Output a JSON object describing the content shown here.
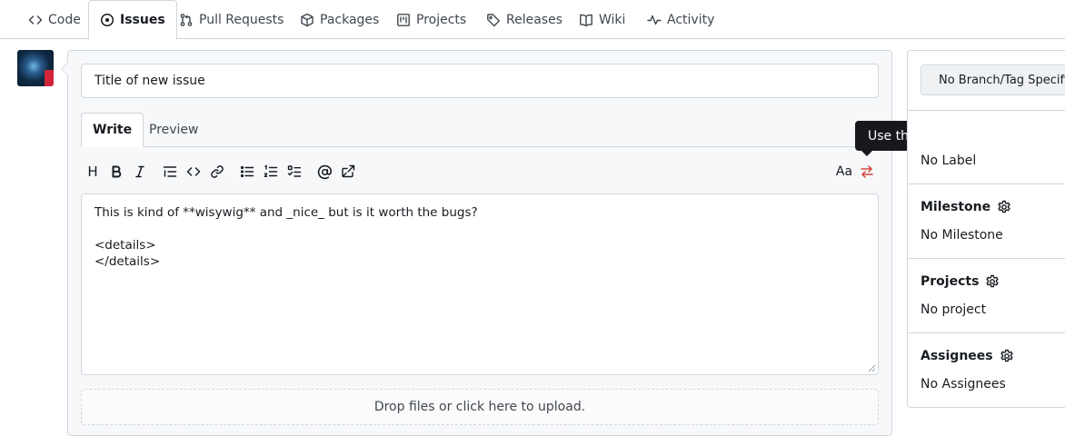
{
  "nav": {
    "tabs": [
      {
        "label": "Code",
        "icon": "code-icon"
      },
      {
        "label": "Issues",
        "icon": "issue-icon",
        "active": true
      },
      {
        "label": "Pull Requests",
        "icon": "pull-request-icon"
      },
      {
        "label": "Packages",
        "icon": "package-icon"
      },
      {
        "label": "Projects",
        "icon": "project-icon"
      },
      {
        "label": "Releases",
        "icon": "tag-icon"
      },
      {
        "label": "Wiki",
        "icon": "book-icon"
      },
      {
        "label": "Activity",
        "icon": "pulse-icon"
      }
    ]
  },
  "issue": {
    "title_placeholder": "Title of new issue",
    "tabs": {
      "write": "Write",
      "preview": "Preview"
    },
    "toolbar": {
      "heading": "H",
      "font_toggle": "Aa"
    },
    "body": "This is kind of **wisywig** and _nice_ but is it worth the bugs?\n\n<details>\n</details>",
    "dropzone": "Drop files or click here to upload.",
    "tooltip": "Use the legacy editor instead"
  },
  "sidebar": {
    "branch_button": "No Branch/Tag Specified",
    "labels_value": "No Label",
    "milestone": {
      "heading": "Milestone",
      "value": "No Milestone"
    },
    "projects": {
      "heading": "Projects",
      "value": "No project"
    },
    "assignees": {
      "heading": "Assignees",
      "value": "No Assignees"
    }
  },
  "colors": {
    "accent": "#d0453a",
    "border": "#d0d7de",
    "tooltip_bg": "#16181c"
  }
}
